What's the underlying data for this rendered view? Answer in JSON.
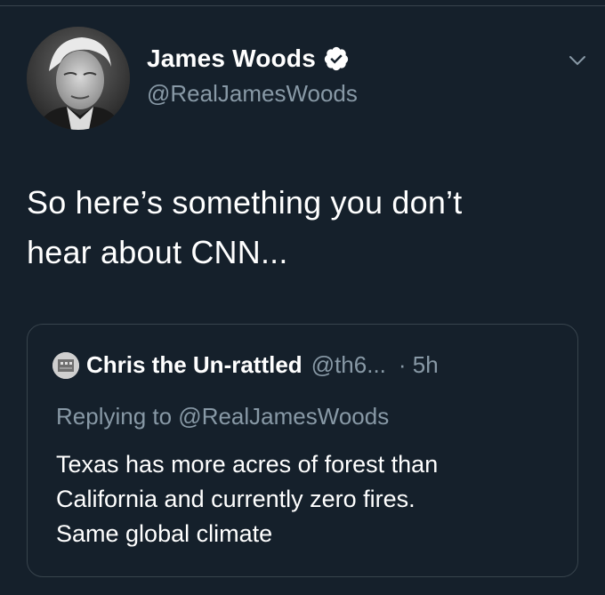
{
  "author": {
    "display_name": "James Woods",
    "handle": "@RealJamesWoods",
    "avatar_icon": "avatar-photo",
    "verified_icon": "verified-badge-icon"
  },
  "tweet": {
    "text_line1": "So here’s something you don’t",
    "text_line2": "hear about CNN..."
  },
  "quoted_tweet": {
    "display_name": "Chris the Un-rattled",
    "handle": "@th6...",
    "time": "· 5h",
    "replying_to": "Replying to @RealJamesWoods",
    "text_line1": "Texas has more acres of forest than",
    "text_line2": "California and currently zero fires.",
    "text_line3": "Same global climate"
  },
  "colors": {
    "background": "#15202b",
    "secondary_text": "#8899a6",
    "border": "#38444d"
  }
}
